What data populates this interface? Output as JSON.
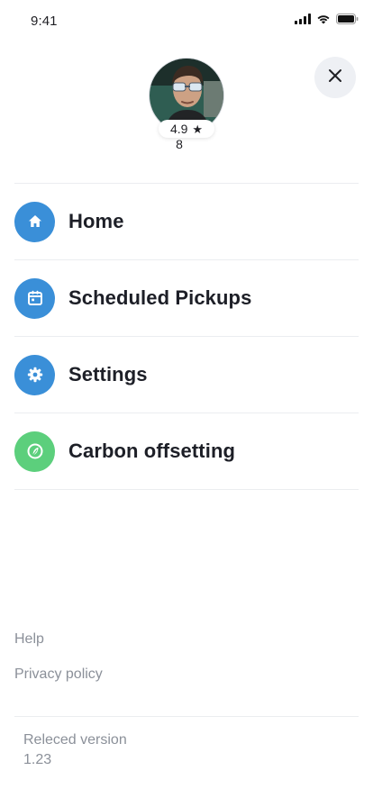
{
  "status_bar": {
    "time": "9:41",
    "icons": [
      "cellular-signal-icon",
      "wifi-icon",
      "battery-icon"
    ]
  },
  "header": {
    "close_icon": "close-icon",
    "avatar": "avatar",
    "rating": "4.9",
    "rating_icon": "star-icon",
    "rides_count": "8"
  },
  "menu": {
    "items": [
      {
        "label": "Home",
        "icon": "home-icon",
        "icon_color": "#3a8fd8"
      },
      {
        "label": "Scheduled Pickups",
        "icon": "calendar-icon",
        "icon_color": "#3a8fd8"
      },
      {
        "label": "Settings",
        "icon": "gear-icon",
        "icon_color": "#3a8fd8"
      },
      {
        "label": "Carbon offsetting",
        "icon": "leaf-icon",
        "icon_color": "#5ccf7c"
      }
    ]
  },
  "footer": {
    "help": "Help",
    "privacy_policy": "Privacy policy",
    "version_label": "Releced version",
    "version_number": "1.23"
  },
  "colors": {
    "accent_blue": "#3a8fd8",
    "accent_green": "#5ccf7c",
    "muted_text": "#8b9099",
    "divider": "#ebedf0",
    "close_button_bg": "#eef0f4"
  }
}
